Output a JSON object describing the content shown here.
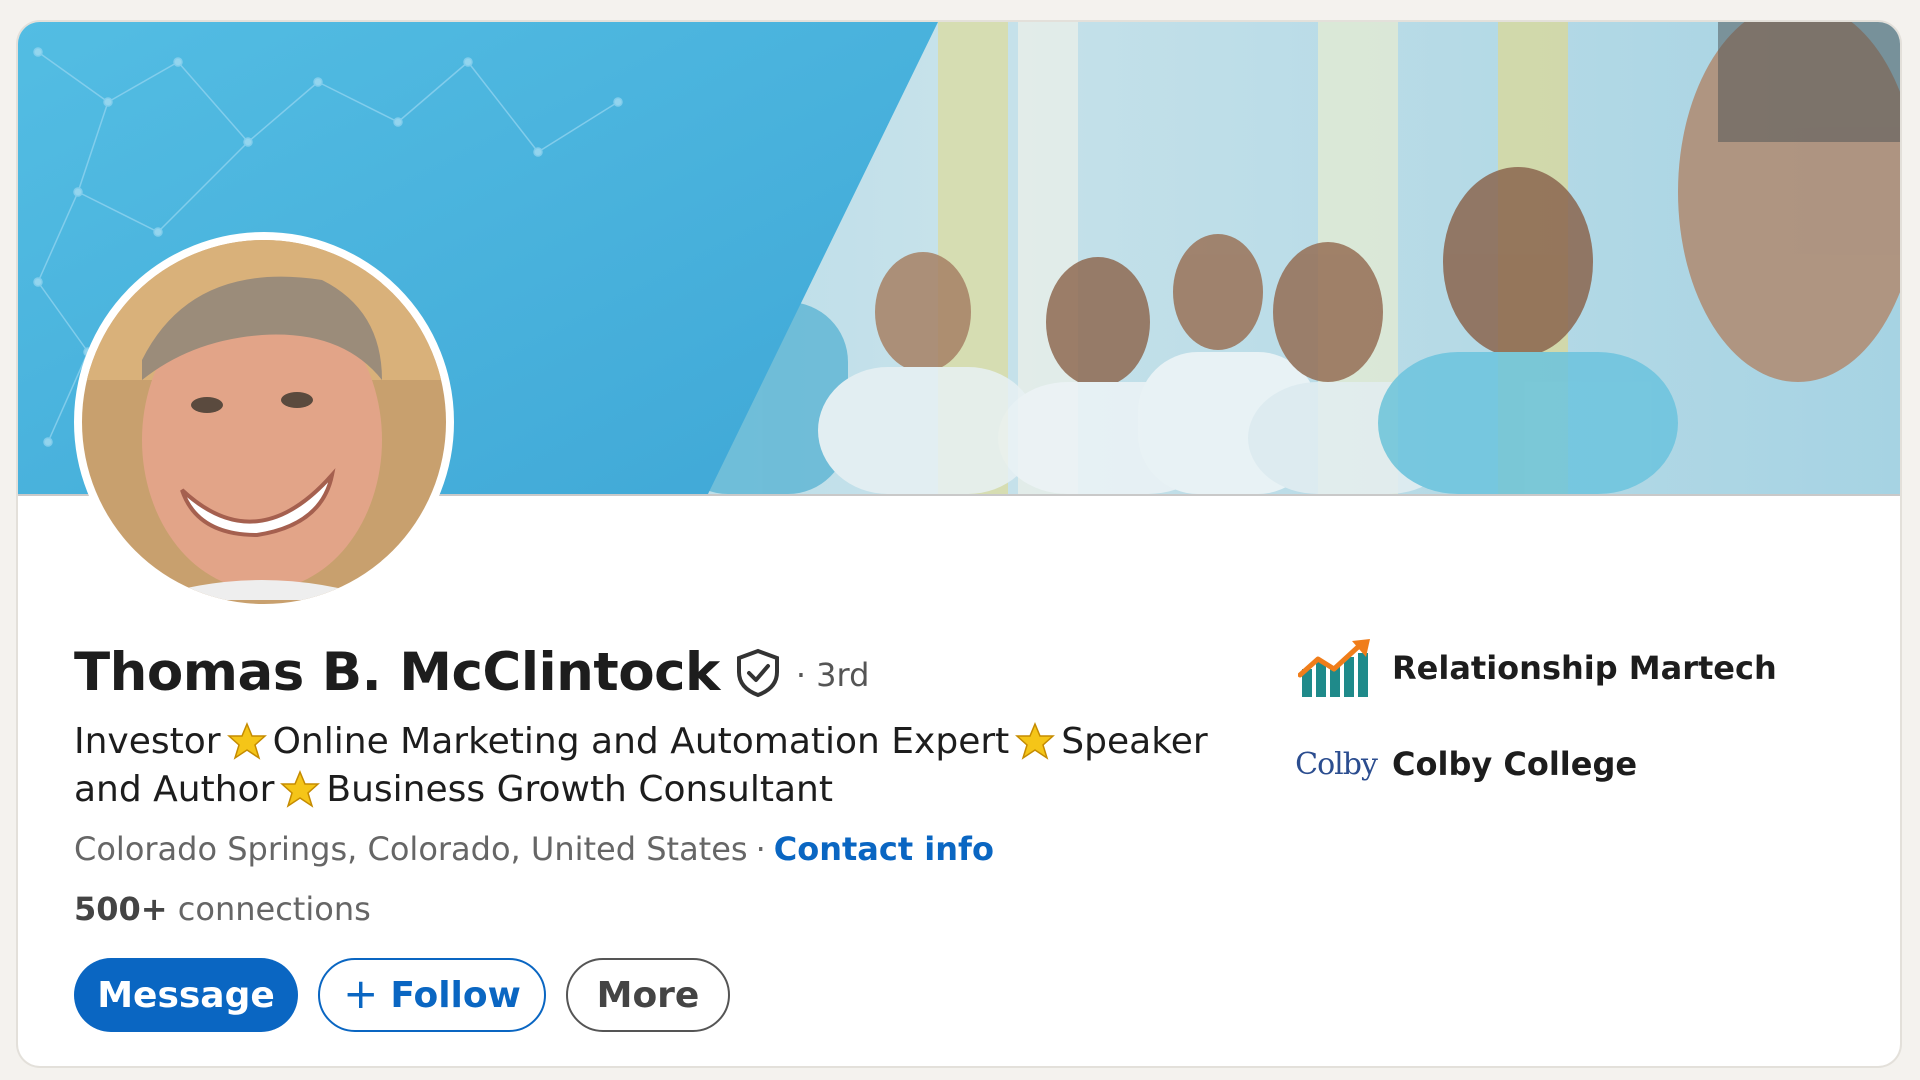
{
  "profile": {
    "name": "Thomas B. McClintock",
    "degree": "· 3rd",
    "headline": {
      "seg1": "Investor",
      "seg2": "Online Marketing and Automation Expert",
      "seg3": "Speaker and Author",
      "seg4": "Business Growth Consultant"
    },
    "location": "Colorado Springs, Colorado, United States",
    "location_sep": "·",
    "contact_info": "Contact info",
    "connections_count": "500+",
    "connections_label": "connections"
  },
  "actions": {
    "message": "Message",
    "follow_plus": "+",
    "follow": "Follow",
    "more": "More"
  },
  "sidebar": {
    "company": "Relationship Martech",
    "school_logo_text": "Colby",
    "school": "Colby College"
  },
  "colors": {
    "accent": "#0a66c2",
    "banner_blue": "#4bb3de",
    "star": "#f5c518"
  }
}
